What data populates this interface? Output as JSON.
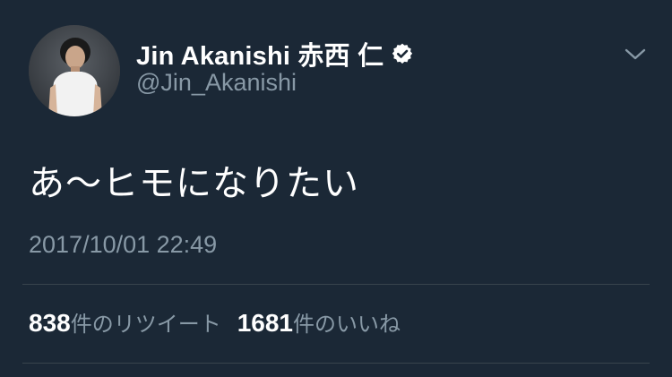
{
  "tweet": {
    "author": {
      "display_name": "Jin Akanishi  赤西 仁",
      "handle": "@Jin_Akanishi",
      "verified": true,
      "avatar_icon": "profile-photo"
    },
    "text": "あ〜ヒモになりたい",
    "timestamp": "2017/10/01 22:49",
    "stats": {
      "retweets_count": "838",
      "retweets_label": "件のリツイート",
      "likes_count": "1681",
      "likes_label": "件のいいね"
    },
    "menu_icon": "chevron-down-icon"
  },
  "colors": {
    "background": "#1b2836",
    "text_primary": "#ffffff",
    "text_secondary": "#8899a6",
    "divider": "#38444d",
    "verified_badge": "#ffffff"
  }
}
